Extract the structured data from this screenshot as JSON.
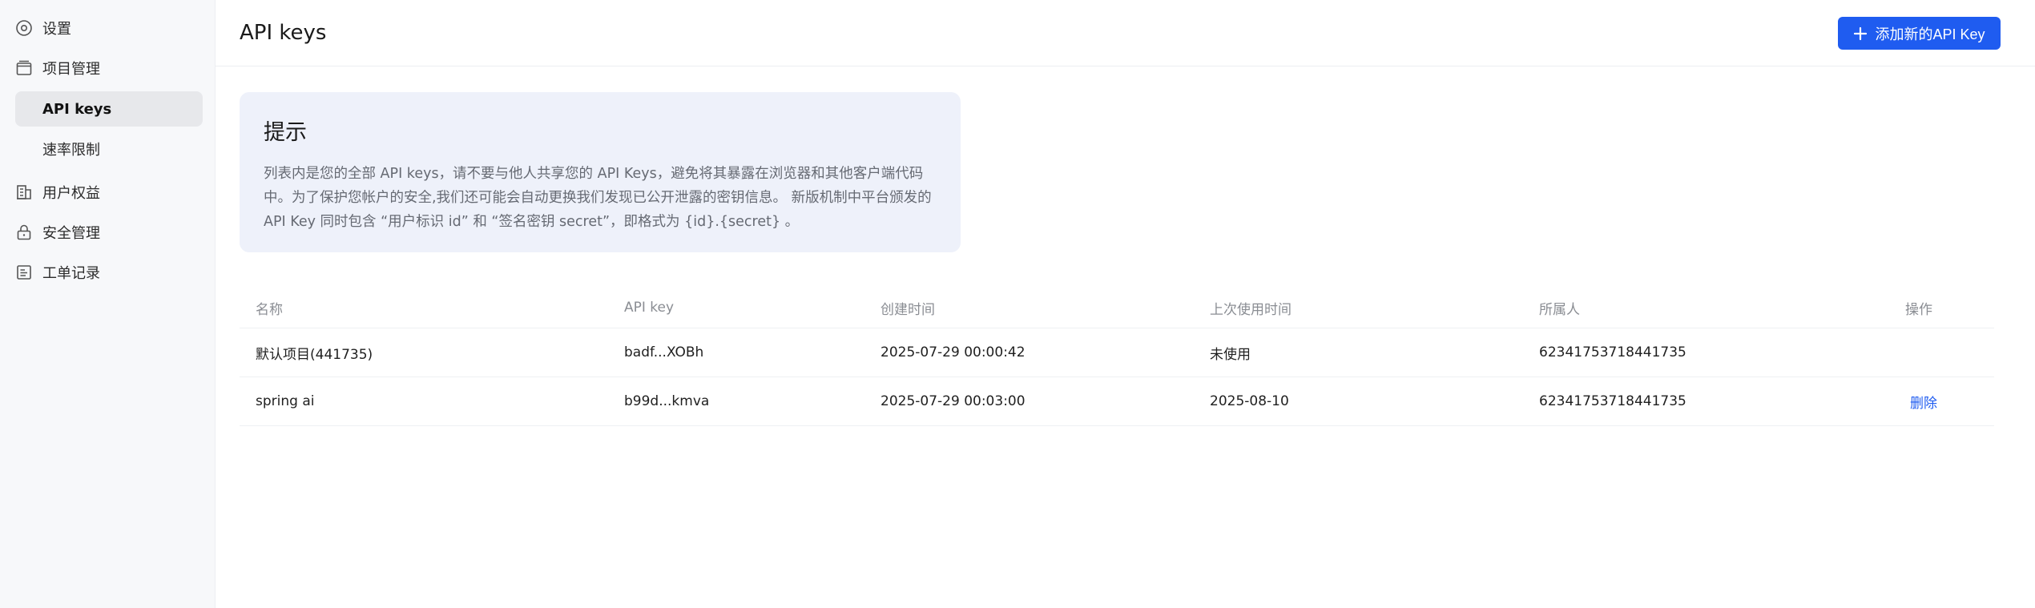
{
  "sidebar": {
    "items": [
      {
        "label": "设置",
        "icon": "settings-icon"
      },
      {
        "label": "项目管理",
        "icon": "folder-icon"
      },
      {
        "label": "API keys",
        "active": true
      },
      {
        "label": "速率限制"
      },
      {
        "label": "用户权益",
        "icon": "building-icon"
      },
      {
        "label": "安全管理",
        "icon": "lock-icon"
      },
      {
        "label": "工单记录",
        "icon": "ticket-icon"
      }
    ]
  },
  "header": {
    "title": "API keys",
    "add_button": "添加新的API Key"
  },
  "tip": {
    "title": "提示",
    "line1": "列表内是您的全部 API keys，请不要与他人共享您的 API Keys，避免将其暴露在浏览器和其他客户端代码",
    "line2": "中。为了保护您帐户的安全,我们还可能会自动更换我们发现已公开泄露的密钥信息。 新版机制中平台颁发的",
    "line3": "API Key 同时包含 “用户标识 id” 和 “签名密钥 secret”，即格式为 {id}.{secret} 。"
  },
  "table": {
    "columns": [
      "名称",
      "API key",
      "创建时间",
      "上次使用时间",
      "所属人",
      "操作"
    ],
    "rows": [
      {
        "name": "默认项目(441735)",
        "key": "badf...XOBh",
        "created": "2025-07-29 00:00:42",
        "last_used": "未使用",
        "owner": "62341753718441735",
        "action": ""
      },
      {
        "name": "spring ai",
        "key": "b99d...kmva",
        "created": "2025-07-29 00:03:00",
        "last_used": "2025-08-10",
        "owner": "62341753718441735",
        "action": "删除"
      }
    ]
  },
  "colors": {
    "accent": "#1f5cf0",
    "tip_bg": "#eef1fa",
    "sidebar_bg": "#f7f8fa"
  }
}
